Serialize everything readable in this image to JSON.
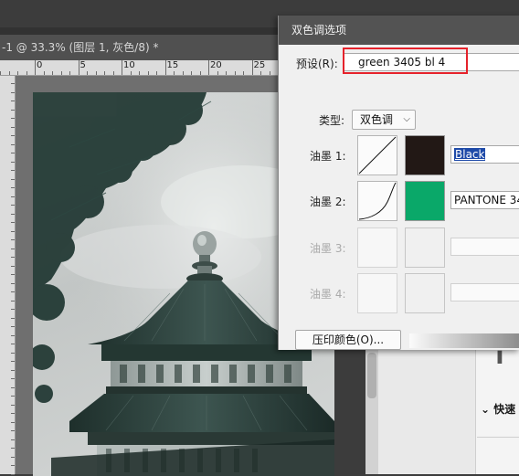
{
  "document": {
    "tab_title": "-1 @ 33.3% (图层 1, 灰色/8) *"
  },
  "ruler": {
    "h_labels": [
      "0",
      "5",
      "10",
      "15",
      "20",
      "25"
    ]
  },
  "dialog": {
    "title": "双色调选项",
    "preset_label": "预设(R):",
    "preset_value": "green 3405 bl 4",
    "type_label": "类型:",
    "type_value": "双色调",
    "inks": [
      {
        "label": "油墨 1:",
        "name": "Black",
        "color": "#221815",
        "enabled": true
      },
      {
        "label": "油墨 2:",
        "name": "PANTONE 34",
        "color": "#0aa869",
        "enabled": true
      },
      {
        "label": "油墨 3:",
        "name": "",
        "color": "#f0f0f0",
        "enabled": false
      },
      {
        "label": "油墨 4:",
        "name": "",
        "color": "#f0f0f0",
        "enabled": false
      }
    ],
    "overprint_button": "压印颜色(O)..."
  },
  "panel": {
    "section_title": "快速"
  },
  "colors": {
    "highlight_border": "#e5222b",
    "selection_bg": "#1e4aa8"
  }
}
